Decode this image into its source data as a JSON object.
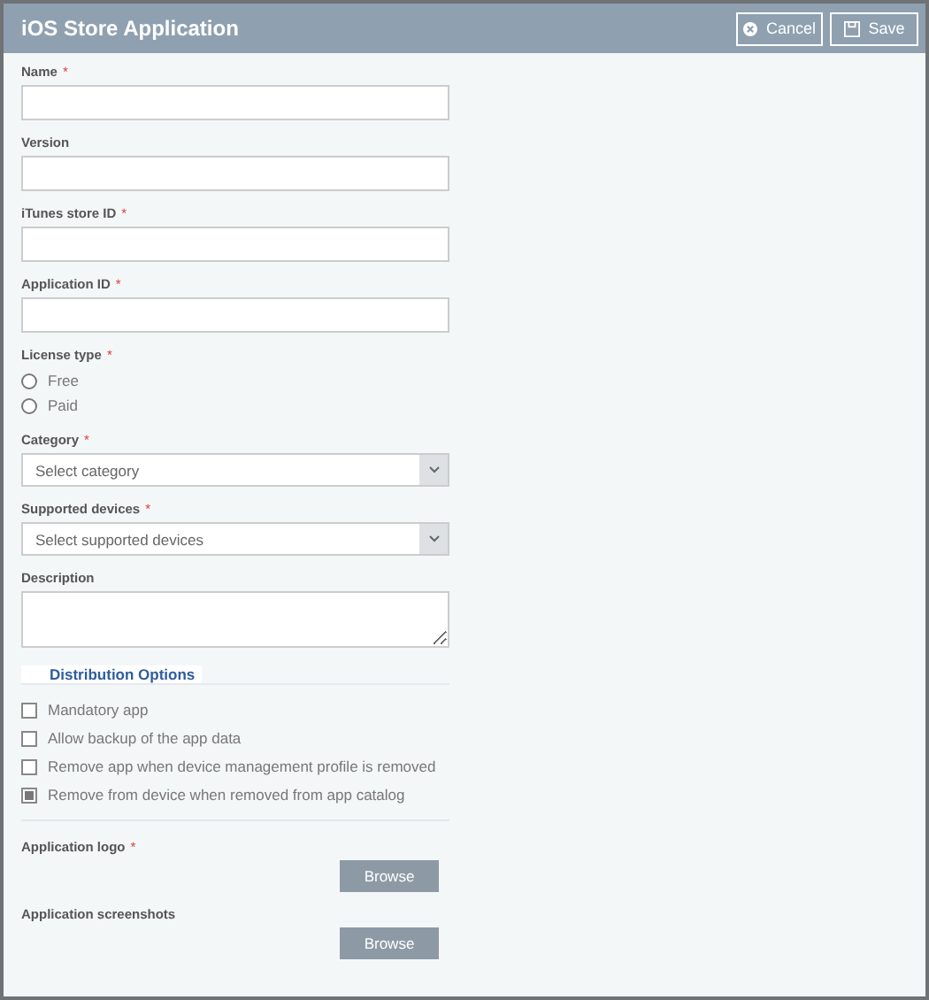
{
  "window": {
    "title": "iOS Store Application"
  },
  "header_buttons": [
    {
      "label": "Cancel",
      "kind": "cancel"
    },
    {
      "label": "Save",
      "kind": "save"
    }
  ],
  "fields": [
    {
      "label": "Name",
      "required_mark": "*",
      "kind": "text"
    },
    {
      "label": "Version",
      "kind": "text"
    },
    {
      "label": "iTunes store ID",
      "required_mark": "*",
      "kind": "text"
    },
    {
      "label": "Application ID",
      "required_mark": "*",
      "kind": "text"
    },
    {
      "label": "License type",
      "required_mark": "*",
      "kind": "radio",
      "options": [
        {
          "label": "Free",
          "selected": false
        },
        {
          "label": "Paid",
          "selected": false
        }
      ]
    },
    {
      "label": "Category",
      "required_mark": "*",
      "kind": "select",
      "placeholder": "Select category"
    },
    {
      "label": "Supported devices",
      "required_mark": "*",
      "kind": "select",
      "placeholder": "Select supported devices"
    },
    {
      "label": "Description",
      "kind": "textarea"
    }
  ],
  "distribution": {
    "title": "Distribution Options",
    "options": [
      {
        "label": "Mandatory app",
        "checked": false
      },
      {
        "label": "Allow backup of the app data",
        "checked": false
      },
      {
        "label": "Remove app when device management profile is removed",
        "checked": false
      },
      {
        "label": "Remove from device when removed from app catalog",
        "checked": true
      }
    ]
  },
  "uploads": [
    {
      "label": "Application logo",
      "required_mark": "*",
      "button": "Browse"
    },
    {
      "label": "Application screenshots",
      "button": "Browse"
    }
  ]
}
